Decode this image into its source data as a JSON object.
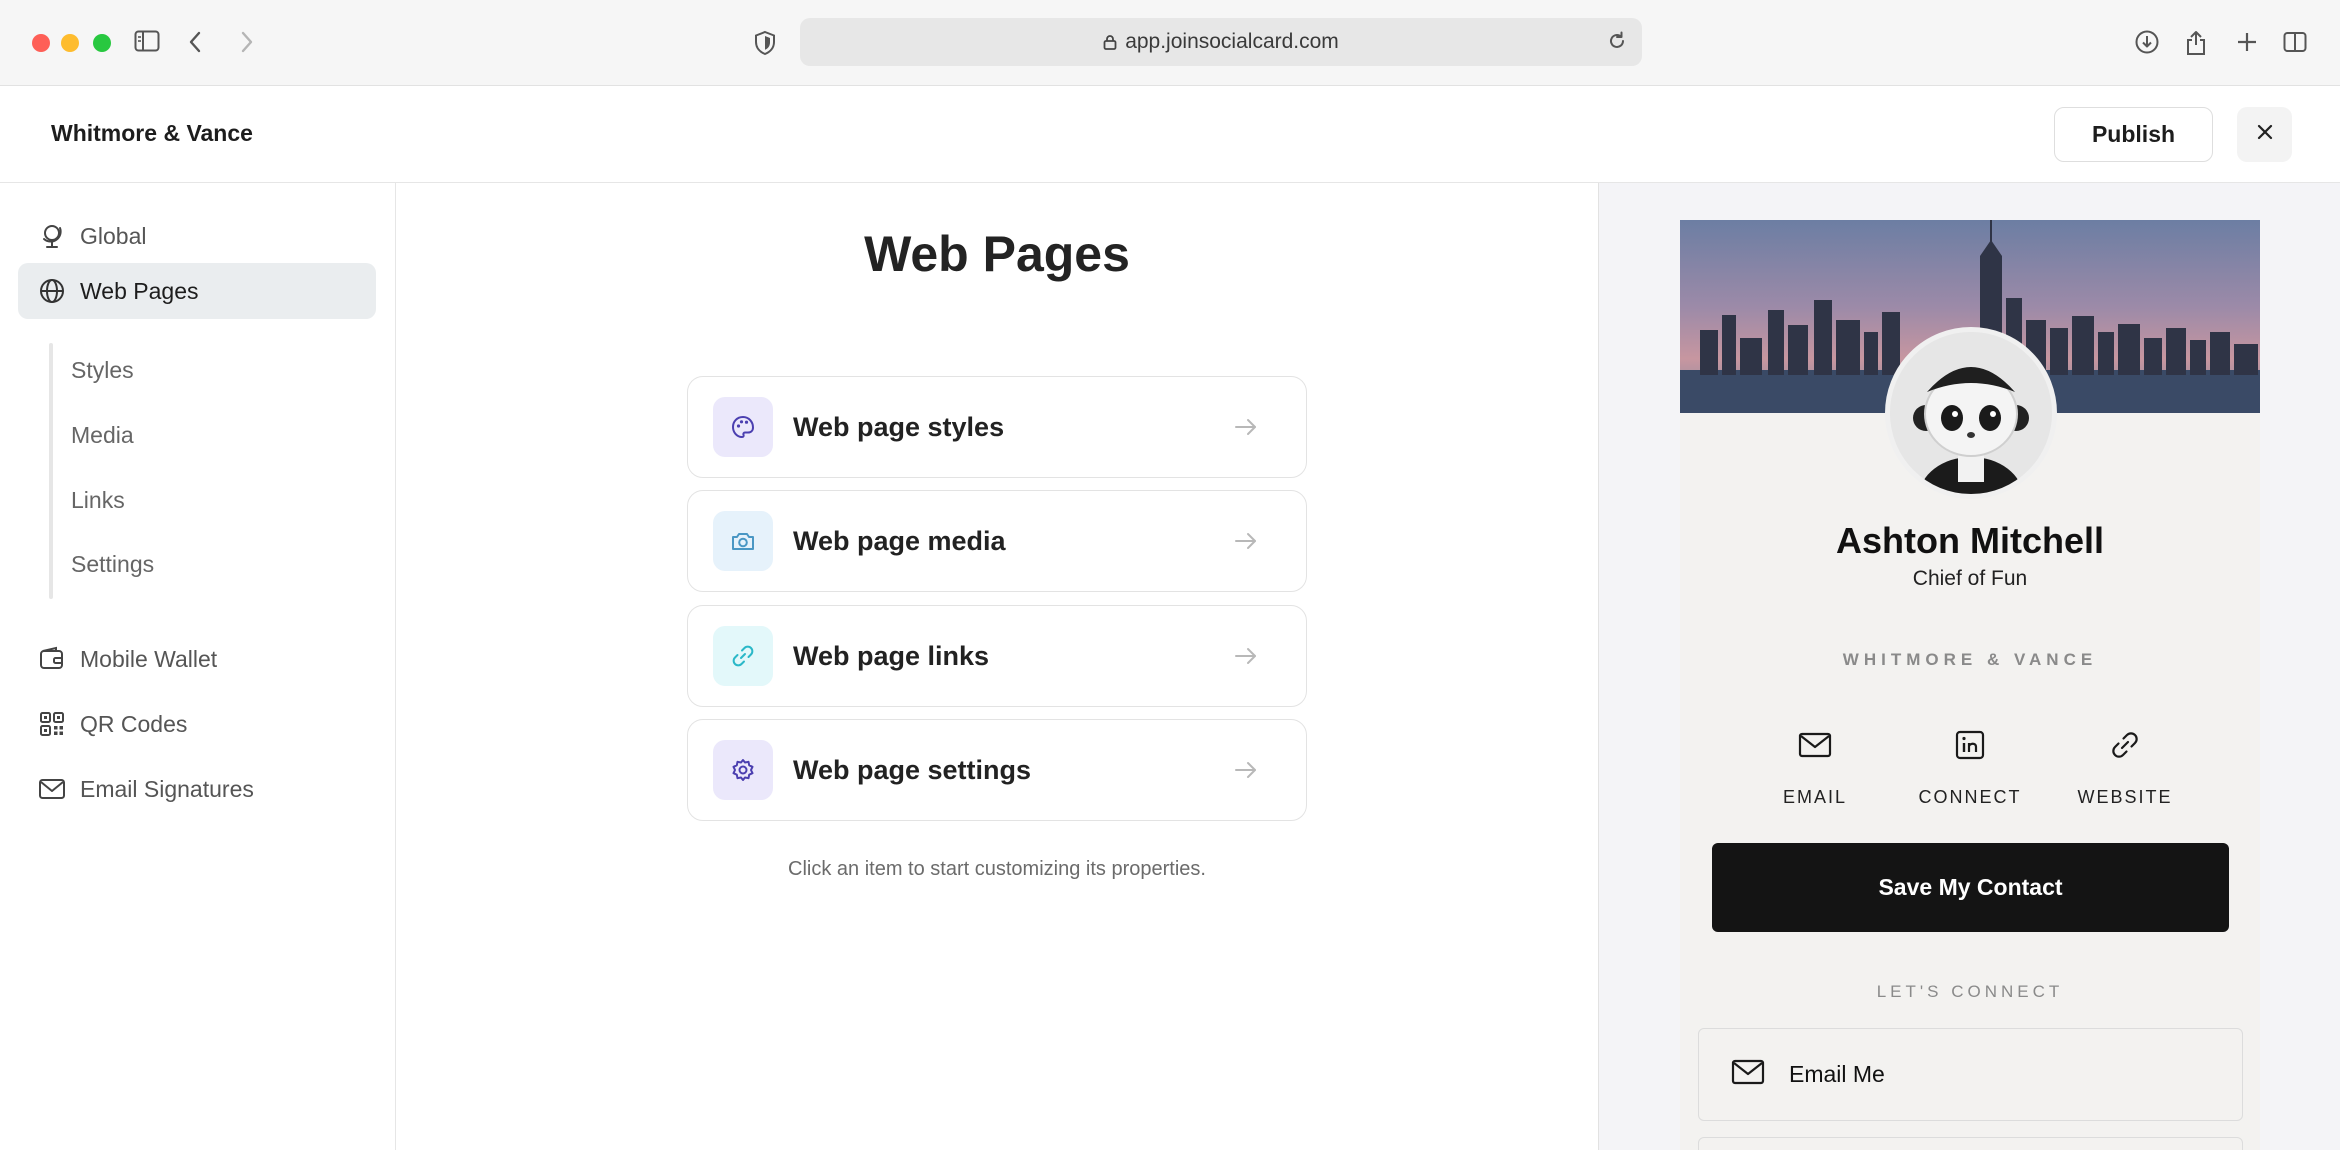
{
  "browser": {
    "url": "app.joinsocialcard.com"
  },
  "header": {
    "brand": "Whitmore & Vance",
    "publish_label": "Publish"
  },
  "sidebar": {
    "items": [
      {
        "label": "Global",
        "icon": "globe-stand-icon"
      },
      {
        "label": "Web Pages",
        "icon": "globe-icon"
      },
      {
        "label": "Mobile Wallet",
        "icon": "wallet-icon"
      },
      {
        "label": "QR Codes",
        "icon": "qr-code-icon"
      },
      {
        "label": "Email Signatures",
        "icon": "mail-icon"
      }
    ],
    "sub_items": [
      "Styles",
      "Media",
      "Links",
      "Settings"
    ]
  },
  "main": {
    "title": "Web Pages",
    "cards": [
      {
        "label": "Web page styles",
        "icon": "palette-icon",
        "color": "#ebe8fb"
      },
      {
        "label": "Web page media",
        "icon": "camera-icon",
        "color": "#e6f2fb"
      },
      {
        "label": "Web page links",
        "icon": "link-icon",
        "color": "#e3f8fa"
      },
      {
        "label": "Web page settings",
        "icon": "gear-icon",
        "color": "#ebe8fb"
      }
    ],
    "hint": "Click an item to start customizing its properties."
  },
  "preview": {
    "name": "Ashton Mitchell",
    "role": "Chief of Fun",
    "company": "WHITMORE & VANCE",
    "actions": [
      "EMAIL",
      "CONNECT",
      "WEBSITE"
    ],
    "save_label": "Save My Contact",
    "lets_connect": "LET'S CONNECT",
    "email_label": "Email Me"
  }
}
